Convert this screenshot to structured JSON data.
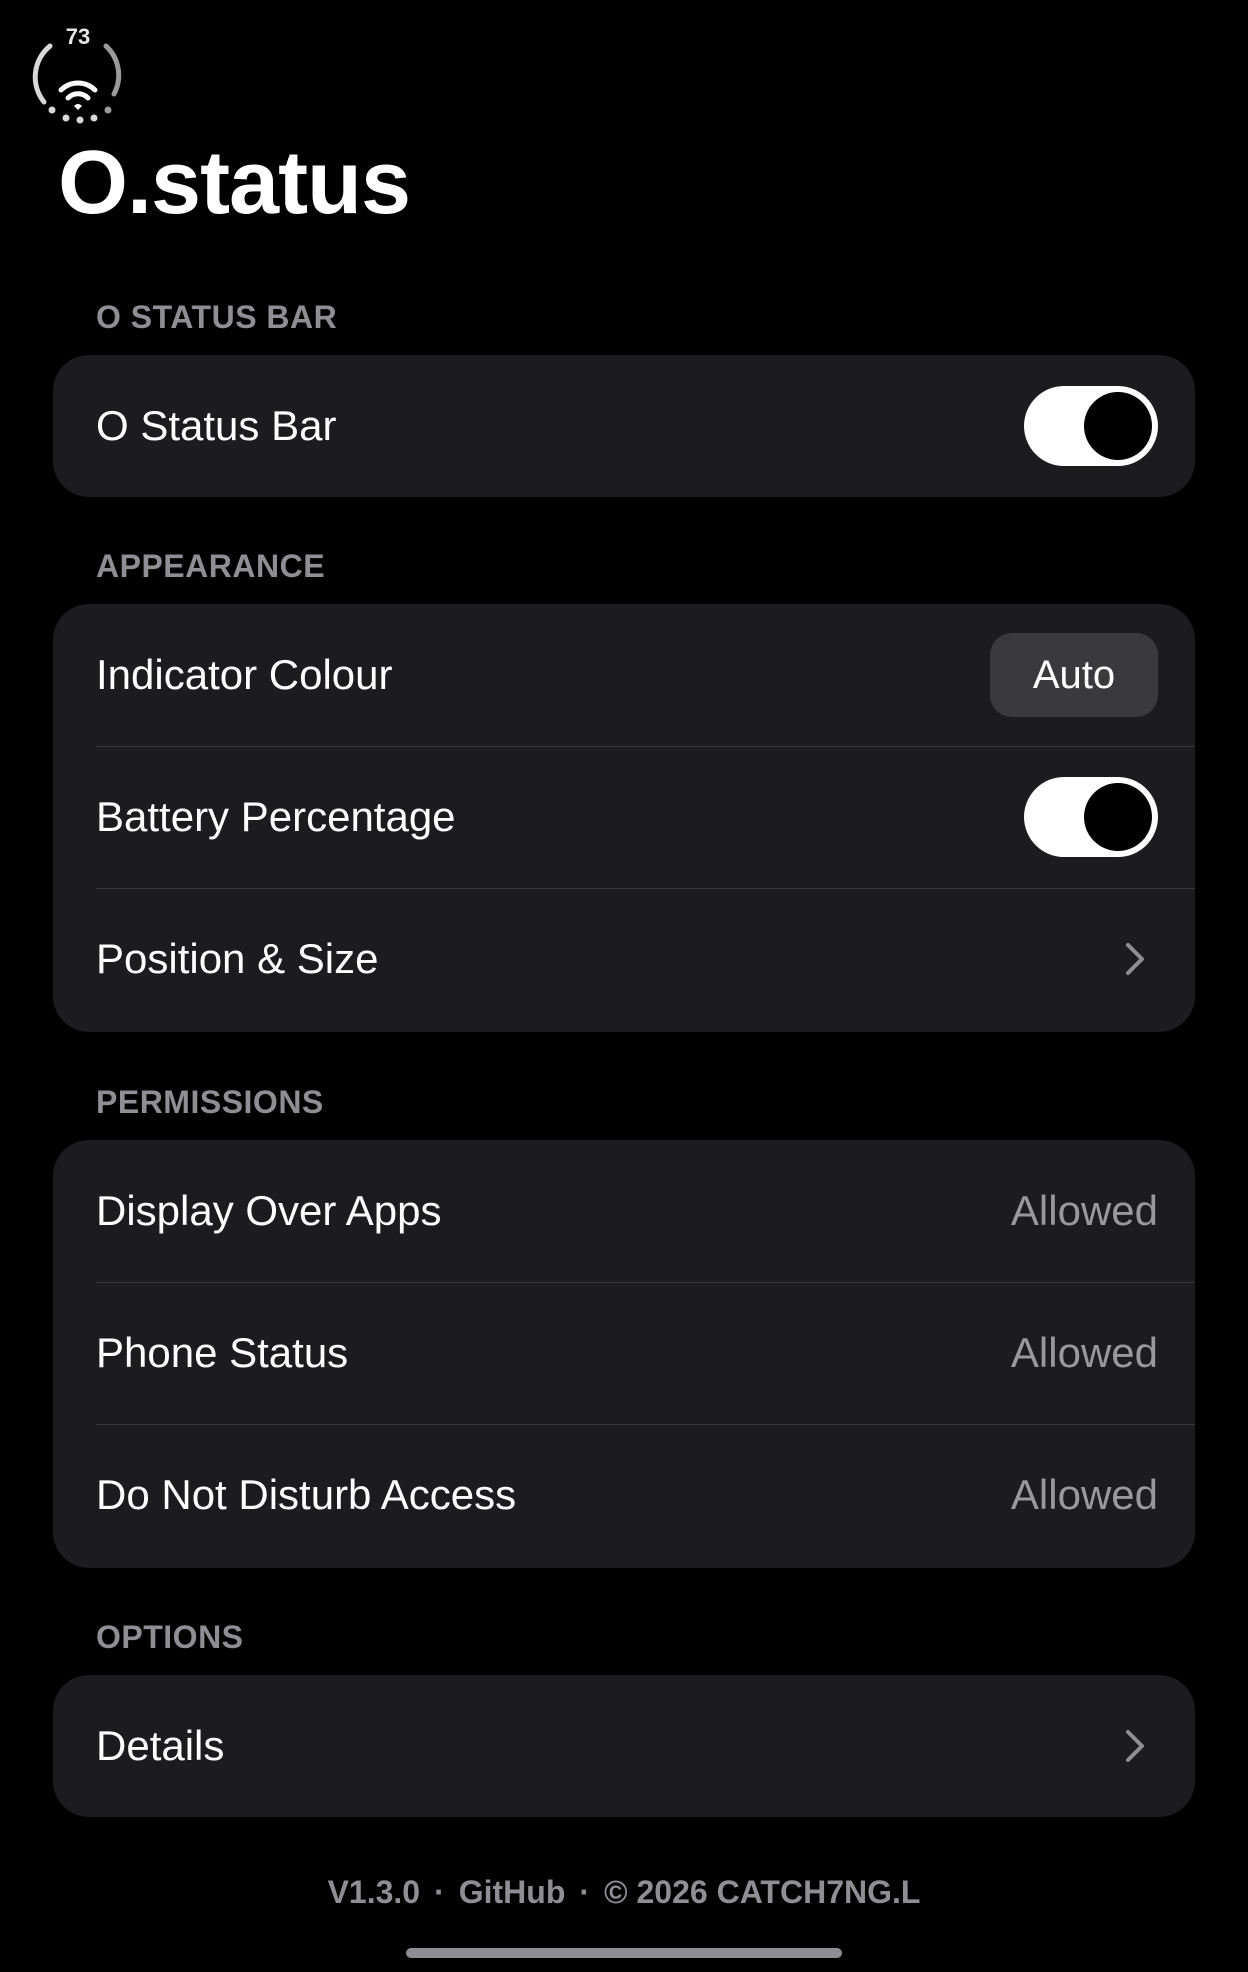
{
  "status_indicator": {
    "battery_number": "73",
    "icon": "wifi-icon"
  },
  "app": {
    "title": "O.status"
  },
  "sections": {
    "status_bar": {
      "header": "O STATUS BAR",
      "rows": [
        {
          "label": "O Status Bar",
          "toggle_on": true
        }
      ]
    },
    "appearance": {
      "header": "APPEARANCE",
      "rows": [
        {
          "label": "Indicator Colour",
          "button_label": "Auto"
        },
        {
          "label": "Battery Percentage",
          "toggle_on": true
        },
        {
          "label": "Position & Size",
          "icon": "chevron-right-icon"
        }
      ]
    },
    "permissions": {
      "header": "PERMISSIONS",
      "rows": [
        {
          "label": "Display Over Apps",
          "value": "Allowed"
        },
        {
          "label": "Phone Status",
          "value": "Allowed"
        },
        {
          "label": "Do Not Disturb Access",
          "value": "Allowed"
        }
      ]
    },
    "options": {
      "header": "OPTIONS",
      "rows": [
        {
          "label": "Details",
          "icon": "chevron-right-icon"
        }
      ]
    }
  },
  "footer": {
    "version": "V1.3.0",
    "separator": "·",
    "github": "GitHub",
    "copyright": "© 2026 CATCH7NG.L"
  },
  "colors": {
    "background": "#000000",
    "card": "#1c1c1e",
    "secondary_text": "#8e8e93",
    "button_bg": "#3a3a3c",
    "toggle_track": "#ffffff",
    "toggle_knob": "#000000"
  }
}
